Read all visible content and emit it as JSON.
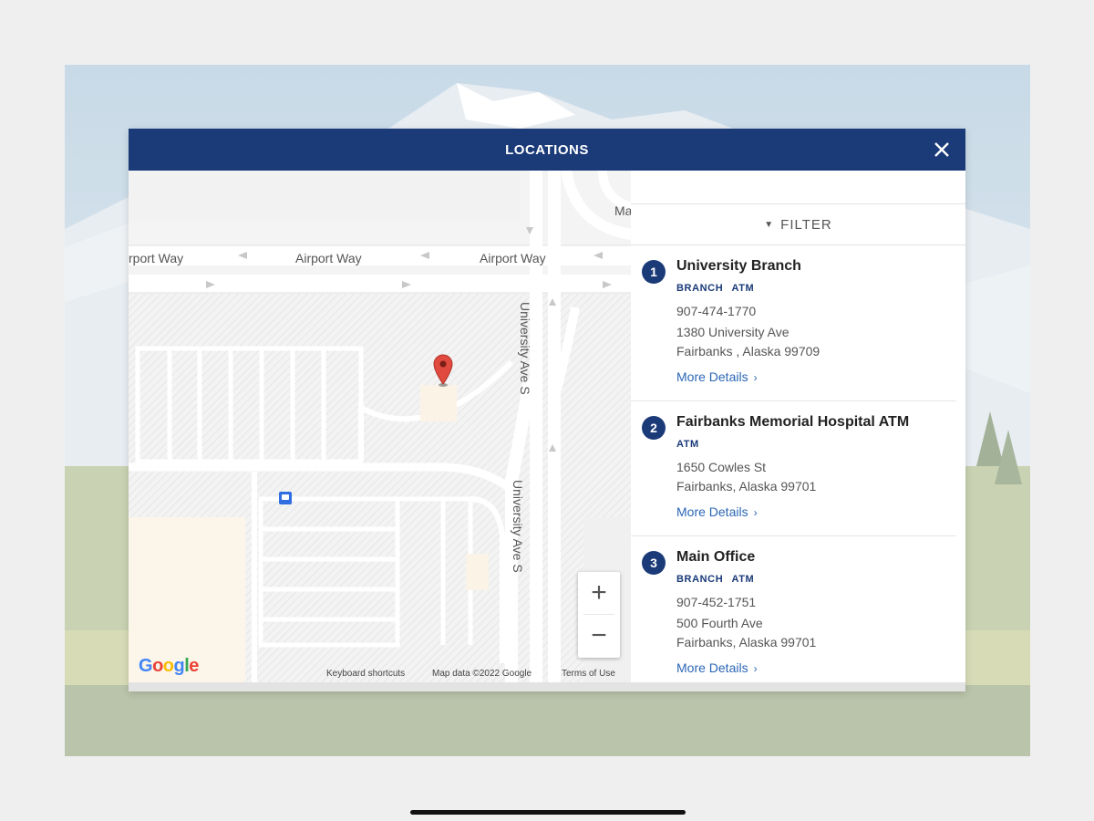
{
  "modal": {
    "title": "LOCATIONS",
    "close_icon": "close-icon"
  },
  "map": {
    "roads": {
      "airport_way_1": "rport Way",
      "airport_way_2": "Airport Way",
      "airport_way_3": "Airport Way",
      "university_1": "University Ave S",
      "university_2": "University Ave S",
      "partial": "Ma"
    },
    "zoom_in": "+",
    "zoom_out": "−",
    "google_logo": "Google",
    "keyboard_shortcuts": "Keyboard shortcuts",
    "map_data": "Map data ©2022 Google",
    "terms": "Terms of Use",
    "marker_icon": "location-pin-icon",
    "marker_color": "#e04a3f"
  },
  "panel": {
    "filter_label": "FILTER",
    "filter_icon": "chevron-down-icon",
    "locations": [
      {
        "number": "1",
        "name": "University Branch",
        "tags": [
          "BRANCH",
          "ATM"
        ],
        "phone": "907-474-1770",
        "address1": "1380 University Ave",
        "address2": "Fairbanks , Alaska 99709",
        "link": "More Details"
      },
      {
        "number": "2",
        "name": "Fairbanks Memorial Hospital ATM",
        "tags": [
          "ATM"
        ],
        "phone": "",
        "address1": "1650 Cowles St",
        "address2": "Fairbanks, Alaska 99701",
        "link": "More Details"
      },
      {
        "number": "3",
        "name": "Main Office",
        "tags": [
          "BRANCH",
          "ATM"
        ],
        "phone": "907-452-1751",
        "address1": "500 Fourth Ave",
        "address2": "Fairbanks, Alaska 99701",
        "link": "More Details"
      }
    ]
  },
  "colors": {
    "header": "#1a3a78",
    "link": "#2a66b5",
    "badge": "#1a3a78"
  }
}
